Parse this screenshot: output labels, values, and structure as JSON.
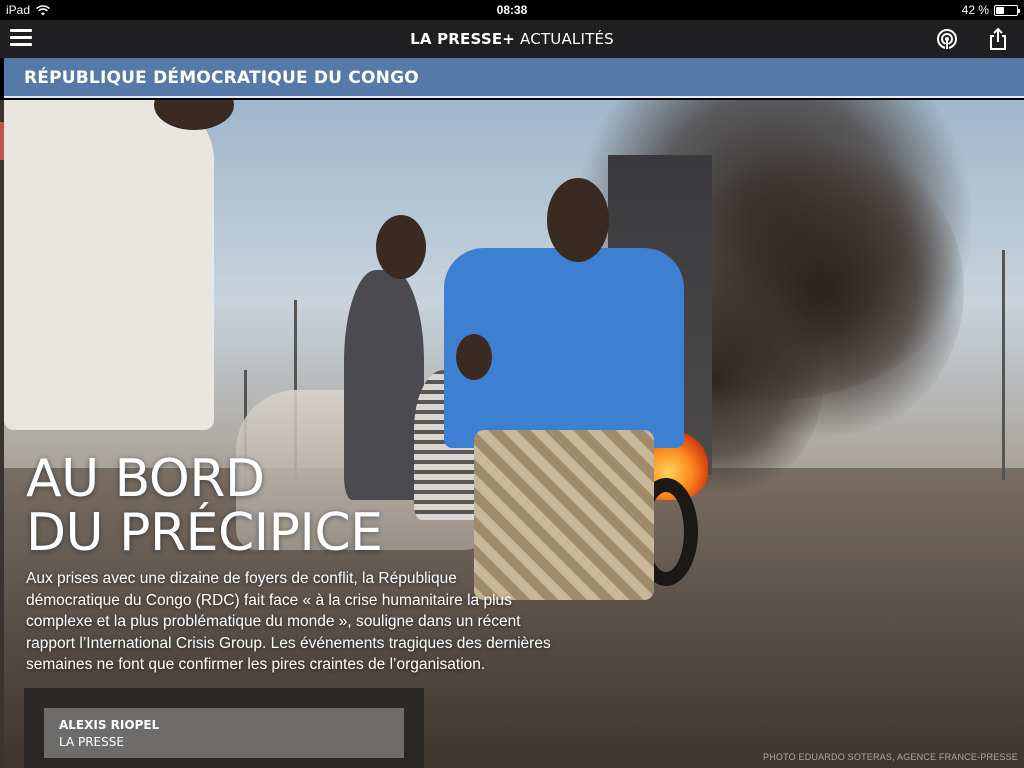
{
  "status_bar": {
    "device": "iPad",
    "time": "08:38",
    "battery_text": "42 %",
    "battery_level": 0.42
  },
  "app_bar": {
    "brand_name": "LA PRESSE+",
    "section": "ACTUALITÉS",
    "icons": [
      "menu-icon",
      "podcast-icon",
      "share-icon"
    ]
  },
  "section_banner": {
    "label": "RÉPUBLIQUE DÉMOCRATIQUE DU CONGO",
    "color": "#557aa9"
  },
  "article": {
    "headline_line1": "AU BORD",
    "headline_line2": "DU PRÉCIPICE",
    "lede": "Aux prises avec une dizaine de foyers de conflit, la République démocratique du Congo (RDC) fait face « à la crise humanitaire la plus complexe et la plus problématique du monde », souligne dans un récent rapport l’International Crisis Group. Les événements tragiques des dernières semaines ne font que confirmer les pires craintes de l’organisation.",
    "author": "ALEXIS RIOPEL",
    "outlet": "LA PRESSE",
    "photo_credit": "PHOTO EDUARDO SOTERAS, AGENCE FRANCE-PRESSE"
  }
}
